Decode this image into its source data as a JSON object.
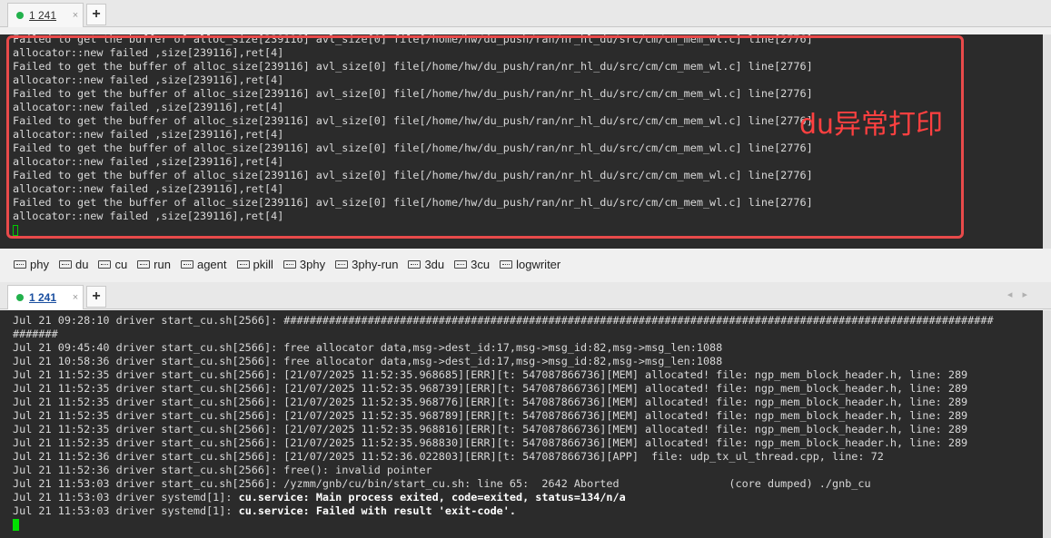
{
  "top_tab": {
    "label": "1 241",
    "close": "×"
  },
  "bottom_tab": {
    "label": "1 241",
    "close": "×"
  },
  "add_tab": "+",
  "top_terminal": {
    "lines": [
      "Failed to get the buffer of alloc_size[239116] avl_size[0] file[/home/hw/du_push/ran/nr_hl_du/src/cm/cm_mem_wl.c] line[2776]",
      "allocator::new failed ,size[239116],ret[4]",
      "Failed to get the buffer of alloc_size[239116] avl_size[0] file[/home/hw/du_push/ran/nr_hl_du/src/cm/cm_mem_wl.c] line[2776]",
      "allocator::new failed ,size[239116],ret[4]",
      "Failed to get the buffer of alloc_size[239116] avl_size[0] file[/home/hw/du_push/ran/nr_hl_du/src/cm/cm_mem_wl.c] line[2776]",
      "allocator::new failed ,size[239116],ret[4]",
      "Failed to get the buffer of alloc_size[239116] avl_size[0] file[/home/hw/du_push/ran/nr_hl_du/src/cm/cm_mem_wl.c] line[2776]",
      "allocator::new failed ,size[239116],ret[4]",
      "Failed to get the buffer of alloc_size[239116] avl_size[0] file[/home/hw/du_push/ran/nr_hl_du/src/cm/cm_mem_wl.c] line[2776]",
      "allocator::new failed ,size[239116],ret[4]",
      "Failed to get the buffer of alloc_size[239116] avl_size[0] file[/home/hw/du_push/ran/nr_hl_du/src/cm/cm_mem_wl.c] line[2776]",
      "allocator::new failed ,size[239116],ret[4]",
      "Failed to get the buffer of alloc_size[239116] avl_size[0] file[/home/hw/du_push/ran/nr_hl_du/src/cm/cm_mem_wl.c] line[2776]",
      "allocator::new failed ,size[239116],ret[4]"
    ]
  },
  "annotation": "du异常打印",
  "quick_commands": [
    "phy",
    "du",
    "cu",
    "run",
    "agent",
    "pkill",
    "3phy",
    "3phy-run",
    "3du",
    "3cu",
    "logwriter"
  ],
  "bottom_terminal": {
    "lines": [
      "Jul 21 09:28:10 driver start_cu.sh[2566]: ##############################################################################################################",
      "#######",
      "Jul 21 09:45:40 driver start_cu.sh[2566]: free allocator data,msg->dest_id:17,msg->msg_id:82,msg->msg_len:1088",
      "Jul 21 10:58:36 driver start_cu.sh[2566]: free allocator data,msg->dest_id:17,msg->msg_id:82,msg->msg_len:1088",
      "Jul 21 11:52:35 driver start_cu.sh[2566]: [21/07/2025 11:52:35.968685][ERR][t: 547087866736][MEM] allocated! file: ngp_mem_block_header.h, line: 289",
      "Jul 21 11:52:35 driver start_cu.sh[2566]: [21/07/2025 11:52:35.968739][ERR][t: 547087866736][MEM] allocated! file: ngp_mem_block_header.h, line: 289",
      "Jul 21 11:52:35 driver start_cu.sh[2566]: [21/07/2025 11:52:35.968776][ERR][t: 547087866736][MEM] allocated! file: ngp_mem_block_header.h, line: 289",
      "Jul 21 11:52:35 driver start_cu.sh[2566]: [21/07/2025 11:52:35.968789][ERR][t: 547087866736][MEM] allocated! file: ngp_mem_block_header.h, line: 289",
      "Jul 21 11:52:35 driver start_cu.sh[2566]: [21/07/2025 11:52:35.968816][ERR][t: 547087866736][MEM] allocated! file: ngp_mem_block_header.h, line: 289",
      "Jul 21 11:52:35 driver start_cu.sh[2566]: [21/07/2025 11:52:35.968830][ERR][t: 547087866736][MEM] allocated! file: ngp_mem_block_header.h, line: 289",
      "Jul 21 11:52:36 driver start_cu.sh[2566]: [21/07/2025 11:52:36.022803][ERR][t: 547087866736][APP]  file: udp_tx_ul_thread.cpp, line: 72",
      "Jul 21 11:52:36 driver start_cu.sh[2566]: free(): invalid pointer",
      "Jul 21 11:53:03 driver start_cu.sh[2566]: /yzmm/gnb/cu/bin/start_cu.sh: line 65:  2642 Aborted                 (core dumped) ./gnb_cu"
    ],
    "systemd_lines": [
      {
        "prefix": "Jul 21 11:53:03 driver systemd[1]: ",
        "bold": "cu.service: Main process exited, code=exited, status=134/n/a"
      },
      {
        "prefix": "Jul 21 11:53:03 driver systemd[1]: ",
        "bold": "cu.service: Failed with result 'exit-code'."
      }
    ]
  }
}
